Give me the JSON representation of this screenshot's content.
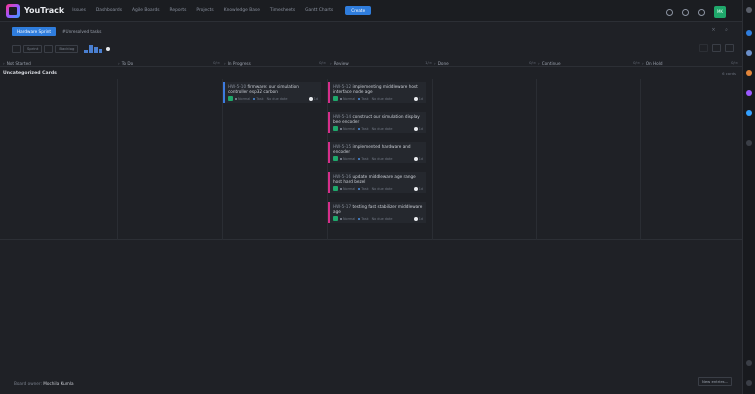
{
  "header": {
    "app_name": "YouTrack",
    "nav": [
      "Issues",
      "Dashboards",
      "Agile Boards",
      "Reports",
      "Projects",
      "Knowledge Base",
      "Timesheets",
      "Gantt Charts"
    ],
    "create_label": "Create",
    "avatar_initials": "MK"
  },
  "board": {
    "name_label": "Hardware Sprint",
    "query": "#Unresolved tasks",
    "toolbar_buttons": [
      "",
      "Sprint",
      "",
      "Backlog"
    ]
  },
  "columns": [
    {
      "name": "Not Started",
      "count": ""
    },
    {
      "name": "To Do",
      "count": "0/∞"
    },
    {
      "name": "In Progress",
      "count": "0/∞"
    },
    {
      "name": "Review",
      "count": "1/∞"
    },
    {
      "name": "Done",
      "count": "0/∞"
    },
    {
      "name": "Continue",
      "count": "0/∞"
    },
    {
      "name": "On Hold",
      "count": "0/∞"
    }
  ],
  "lane": {
    "title": "Uncategorized Cards",
    "meta": "6 cards"
  },
  "cards": [
    {
      "id": "HW-5-10",
      "title": "firmware: our simulation controller esp32 carbon",
      "state": "Normal",
      "type": "Task",
      "due": "No due date",
      "estimate": "1d",
      "accent": "#3d7be0"
    },
    {
      "id": "HW-5-12",
      "title": "implementing middleware host interface node age",
      "state": "Normal",
      "type": "Task",
      "due": "No due date",
      "estimate": "1d",
      "accent": "#d62e8a"
    },
    {
      "id": "HW-5-14",
      "title": "construct our simulation display bee encoder",
      "state": "Normal",
      "type": "Task",
      "due": "No due date",
      "estimate": "1d",
      "accent": "#d62e8a"
    },
    {
      "id": "HW-5-15",
      "title": "implemented hardware and encoder",
      "state": "Normal",
      "type": "Task",
      "due": "No due date",
      "estimate": "1d",
      "accent": "#d62e8a"
    },
    {
      "id": "HW-5-16",
      "title": "update middleware age range host hard bezel",
      "state": "Normal",
      "type": "Task",
      "due": "No due date",
      "estimate": "1d",
      "accent": "#d62e8a"
    },
    {
      "id": "HW-5-17",
      "title": "testing fast stabilizer middleware age",
      "state": "Normal",
      "type": "Task",
      "due": "No due date",
      "estimate": "1d",
      "accent": "#d62e8a"
    }
  ],
  "footer": {
    "owner_prefix": "Board owner:",
    "owner_name": "Mochila Kumla",
    "newest_label": "New entries..."
  }
}
